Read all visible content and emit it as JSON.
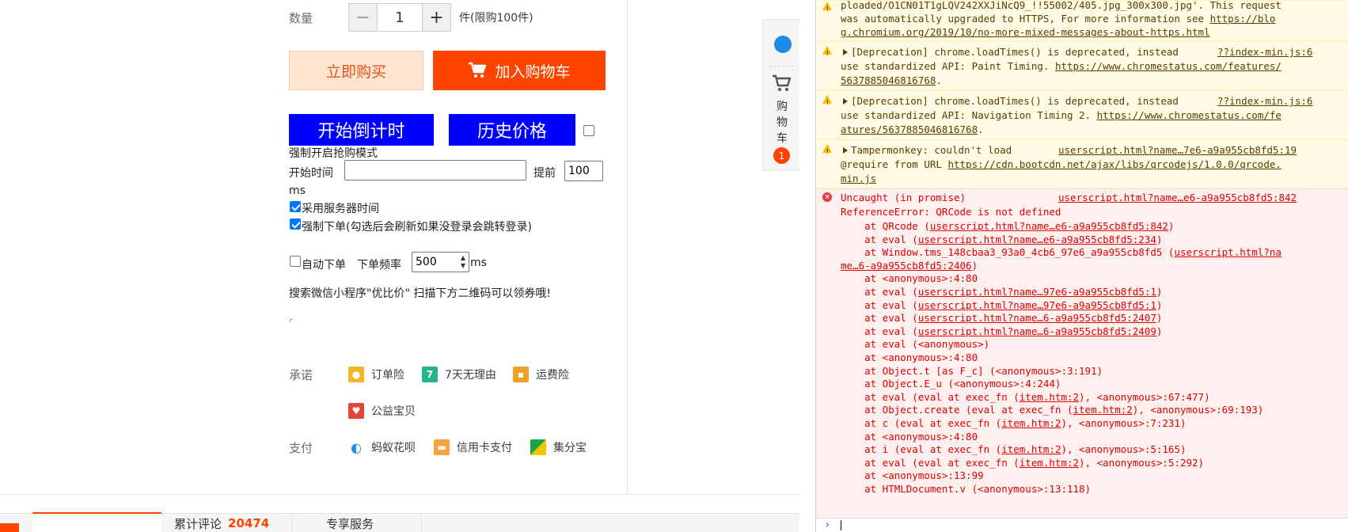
{
  "product": {
    "quantity_label": "数量",
    "quantity_value": "1",
    "decrease_symbol": "−",
    "increase_symbol": "+",
    "quantity_limit": "件(限购100件)",
    "buy_now_label": "立即购买",
    "add_to_cart_label": "加入购物车"
  },
  "tool": {
    "start_countdown_label": "开始倒计时",
    "price_history_label": "历史价格",
    "force_mode_label": "强制开启抢购模式",
    "start_time_label": "开始时间",
    "start_time_value": "",
    "advance_label": "提前",
    "advance_value": "100",
    "ms_label": "ms",
    "use_server_time_label": "采用服务器时间",
    "force_order_label": "强制下单(勾选后会刷新如果没登录会跳转登录)",
    "auto_order_label": "自动下单",
    "order_freq_label": "下单频率",
    "order_freq_value": "500",
    "ms_label2": "ms",
    "wechat_tip": "搜索微信小程序\"优比价\" 扫描下方二维码可以领券哦!"
  },
  "promise": {
    "label": "承诺",
    "items": [
      "订单险",
      "7天无理由",
      "运费险",
      "公益宝贝"
    ]
  },
  "payment": {
    "label": "支付",
    "items": [
      "蚂蚁花呗",
      "信用卡支付",
      "集分宝"
    ]
  },
  "side": {
    "cart_chars": [
      "购",
      "物",
      "车"
    ],
    "cart_count": "1"
  },
  "tabs": {
    "items": [
      "累计评论",
      "专享服务"
    ],
    "review_count": "20474"
  },
  "console": {
    "warn0": {
      "l1": "ploaded/O1CN01T1gLQV242XXJiNcQ9_!!55002/405.jpg_300x300.jpg'. This request",
      "l2": "was automatically upgraded to HTTPS, For more information see ",
      "l2_link": "https://blo",
      "l3_link": "g.chromium.org/2019/10/no-more-mixed-messages-about-https.html"
    },
    "warn1": {
      "l1": "[Deprecation] chrome.loadTimes() is deprecated, instead",
      "src": "??index-min.js:6",
      "l2": "use standardized API: Paint Timing. ",
      "l2_link": "https://www.chromestatus.com/features/",
      "l3_link": "5637885046816768",
      "l3_tail": "."
    },
    "warn2": {
      "l1": "[Deprecation] chrome.loadTimes() is deprecated, instead",
      "src": "??index-min.js:6",
      "l2": "use standardized API: Navigation Timing 2. ",
      "l2_link": "https://www.chromestatus.com/fe",
      "l3_link": "atures/5637885046816768",
      "l3_tail": "."
    },
    "warn3": {
      "l1": "Tampermonkey: couldn't load",
      "src": "userscript.html?name…7e6-a9a955cb8fd5:19",
      "l2": "@require from URL ",
      "l2_link": "https://cdn.bootcdn.net/ajax/libs/qrcodejs/1.0.0/qrcode.",
      "l3_link": "min.js"
    },
    "error": {
      "head": "Uncaught (in promise)",
      "src": "userscript.html?name…e6-a9a955cb8fd5:842",
      "msg": "ReferenceError: QRCode is not defined",
      "stack": [
        {
          "pre": "    at QRcode (",
          "link": "userscript.html?name…e6-a9a955cb8fd5:842",
          "post": ")"
        },
        {
          "pre": "    at eval (",
          "link": "userscript.html?name…e6-a9a955cb8fd5:234",
          "post": ")"
        },
        {
          "pre": "    at Window.tms_148cbaa3_93a0_4cb6_97e6_a9a955cb8fd5 (",
          "link": "userscript.html?na",
          "post": ""
        },
        {
          "pre": "",
          "link": "me…6-a9a955cb8fd5:2406",
          "post": ")"
        },
        {
          "pre": "    at <anonymous>:4:80",
          "link": "",
          "post": ""
        },
        {
          "pre": "    at eval (",
          "link": "userscript.html?name…97e6-a9a955cb8fd5:1",
          "post": ")"
        },
        {
          "pre": "    at eval (",
          "link": "userscript.html?name…97e6-a9a955cb8fd5:1",
          "post": ")"
        },
        {
          "pre": "    at eval (",
          "link": "userscript.html?name…6-a9a955cb8fd5:2407",
          "post": ")"
        },
        {
          "pre": "    at eval (",
          "link": "userscript.html?name…6-a9a955cb8fd5:2409",
          "post": ")"
        },
        {
          "pre": "    at eval (<anonymous>)",
          "link": "",
          "post": ""
        },
        {
          "pre": "    at <anonymous>:4:80",
          "link": "",
          "post": ""
        },
        {
          "pre": "    at Object.t [as F_c] (<anonymous>:3:191)",
          "link": "",
          "post": ""
        },
        {
          "pre": "    at Object.E_u (<anonymous>:4:244)",
          "link": "",
          "post": ""
        },
        {
          "pre": "    at eval (eval at exec_fn (",
          "link": "item.htm:2",
          "post": "), <anonymous>:67:477)"
        },
        {
          "pre": "    at Object.create (eval at exec_fn (",
          "link": "item.htm:2",
          "post": "), <anonymous>:69:193)"
        },
        {
          "pre": "    at c (eval at exec_fn (",
          "link": "item.htm:2",
          "post": "), <anonymous>:7:231)"
        },
        {
          "pre": "    at <anonymous>:4:80",
          "link": "",
          "post": ""
        },
        {
          "pre": "    at i (eval at exec_fn (",
          "link": "item.htm:2",
          "post": "), <anonymous>:5:165)"
        },
        {
          "pre": "    at eval (eval at exec_fn (",
          "link": "item.htm:2",
          "post": "), <anonymous>:5:292)"
        },
        {
          "pre": "    at <anonymous>:13:99",
          "link": "",
          "post": ""
        },
        {
          "pre": "    at HTMLDocument.v (<anonymous>:13:118)",
          "link": "",
          "post": ""
        }
      ]
    },
    "prompt_symbol": "›"
  },
  "colors": {
    "accent": "#ff4400",
    "blue_button": "#0000ff",
    "error_text": "#e00000"
  }
}
